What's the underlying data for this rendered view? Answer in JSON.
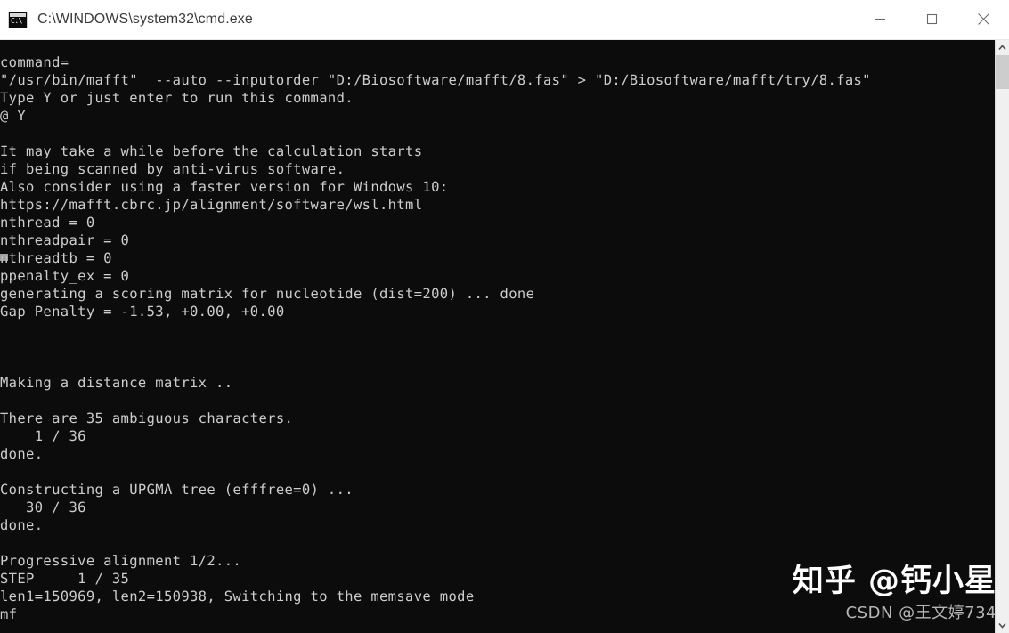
{
  "window": {
    "title": "C:\\WINDOWS\\system32\\cmd.exe",
    "icon_glyph": "C:\\",
    "background_color": "#0c0c0c",
    "titlebar_color": "#ffffff",
    "text_color": "#cdcdcd"
  },
  "window_controls": {
    "minimize_label": "Minimize",
    "maximize_label": "Maximize",
    "close_label": "Close"
  },
  "scrollbar": {
    "up_arrow_label": "Scroll up",
    "down_arrow_label": "Scroll down",
    "thumb_label": "Scroll thumb"
  },
  "console": {
    "lines": [
      "command=",
      "\"/usr/bin/mafft\"  --auto --inputorder \"D:/Biosoftware/mafft/8.fas\" > \"D:/Biosoftware/mafft/try/8.fas\"",
      "Type Y or just enter to run this command.",
      "@ Y",
      "",
      "It may take a while before the calculation starts",
      "if being scanned by anti-virus software.",
      "Also consider using a faster version for Windows 10:",
      "https://mafft.cbrc.jp/alignment/software/wsl.html",
      "nthread = 0",
      "nthreadpair = 0",
      "nthreadtb = 0",
      "ppenalty_ex = 0",
      "generating a scoring matrix for nucleotide (dist=200) ... done",
      "Gap Penalty = -1.53, +0.00, +0.00",
      "",
      "",
      "",
      "Making a distance matrix ..",
      "",
      "There are 35 ambiguous characters.",
      "    1 / 36",
      "done.",
      "",
      "Constructing a UPGMA tree (efffree=0) ...",
      "   30 / 36",
      "done.",
      "",
      "Progressive alignment 1/2...",
      "STEP     1 / 35",
      "len1=150969, len2=150938, Switching to the memsave mode",
      "mf"
    ],
    "full_text": "command=\n\"/usr/bin/mafft\"  --auto --inputorder \"D:/Biosoftware/mafft/8.fas\" > \"D:/Biosoftware/mafft/try/8.fas\"\nType Y or just enter to run this command.\n@ Y\n\nIt may take a while before the calculation starts\nif being scanned by anti-virus software.\nAlso consider using a faster version for Windows 10:\nhttps://mafft.cbrc.jp/alignment/software/wsl.html\nnthread = 0\nnthreadpair = 0\nnthreadtb = 0\nppenalty_ex = 0\ngenerating a scoring matrix for nucleotide (dist=200) ... done\nGap Penalty = -1.53, +0.00, +0.00\n\n\n\nMaking a distance matrix ..\n\nThere are 35 ambiguous characters.\n    1 / 36\ndone.\n\nConstructing a UPGMA tree (efffree=0) ...\n   30 / 36\ndone.\n\nProgressive alignment 1/2...\nSTEP     1 / 35\nlen1=150969, len2=150938, Switching to the memsave mode\nmf"
  },
  "watermarks": {
    "zhihu": "知乎 @钙小星",
    "csdn": "CSDN @王文婷734"
  }
}
